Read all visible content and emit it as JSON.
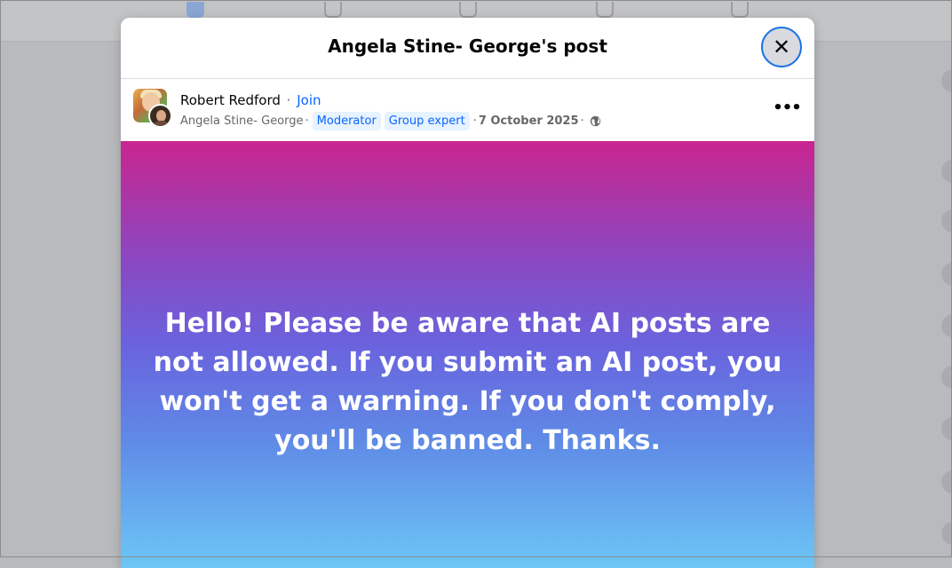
{
  "modal": {
    "title": "Angela Stine- George's post",
    "close_icon": "close-icon"
  },
  "post": {
    "author": "Robert Redford",
    "separator": "·",
    "join_label": "Join",
    "group_name": "Angela Stine- George",
    "badges": [
      "Moderator",
      "Group expert"
    ],
    "date": "7 October 2025",
    "privacy_icon": "globe-icon",
    "more_icon": "more-options-icon",
    "more_label": "•••",
    "body_text": "Hello! Please be aware that AI posts are not allowed. If you submit an AI post, you won't get a warning. If you don't comply, you'll be banned. Thanks.",
    "background_colors": [
      "#c9258f",
      "#6a63de",
      "#6cc6f6"
    ]
  },
  "colors": {
    "link_blue": "#0866ff",
    "badge_bg": "#e7f3ff",
    "focus_ring": "#1b74e4"
  }
}
